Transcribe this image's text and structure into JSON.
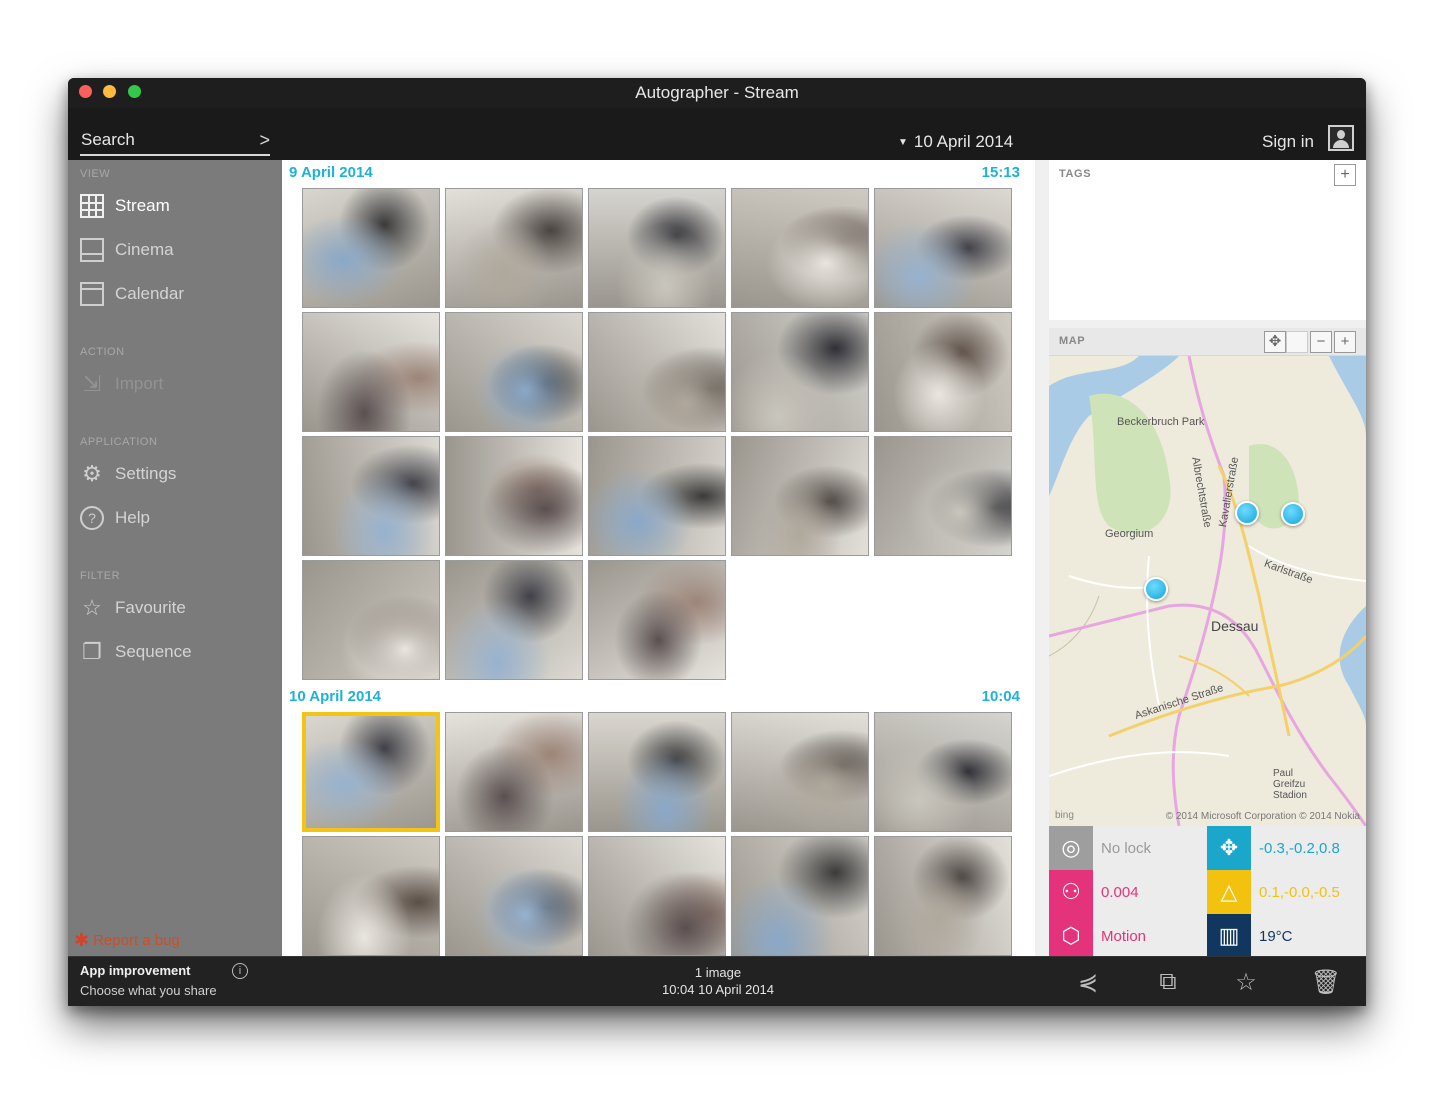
{
  "window": {
    "title": "Autographer - Stream"
  },
  "toolbar": {
    "search_label": "Search",
    "search_chevron": ">",
    "date": "10 April 2014",
    "signin": "Sign in"
  },
  "sidebar": {
    "sections": {
      "view": "VIEW",
      "action": "ACTION",
      "application": "APPLICATION",
      "filter": "FILTER"
    },
    "items": {
      "stream": "Stream",
      "cinema": "Cinema",
      "calendar": "Calendar",
      "import": "Import",
      "settings": "Settings",
      "help": "Help",
      "favourite": "Favourite",
      "sequence": "Sequence"
    },
    "report_bug": "Report a bug"
  },
  "groups": [
    {
      "date": "9 April 2014",
      "time": "15:13",
      "count": 18
    },
    {
      "date": "10 April 2014",
      "time": "10:04",
      "count": 10
    }
  ],
  "right_panel": {
    "tags_label": "TAGS",
    "map_label": "MAP",
    "map_labels": {
      "park": "Beckerbruch Park",
      "georgium": "Georgium",
      "albrecht": "Albrechtstraße",
      "askanische": "Askanische Straße",
      "kavalier": "Kavalierstraße",
      "dessau": "Dessau",
      "karlstrasse": "Karlstraße",
      "paul": "Paul Greifzu Stadion",
      "bing": "bing",
      "copyright": "© 2014 Microsoft Corporation © 2014 Nokia"
    },
    "sensors": {
      "gps": "No lock",
      "accel": "-0.3,-0.2,0.8",
      "light": "0.004",
      "magnet": "0.1,-0.0,-0.5",
      "motion": "Motion",
      "temp": "19°C"
    },
    "colors": {
      "gray": "#9e9e9e",
      "cyan": "#1ba6cc",
      "pink": "#e4337a",
      "yellow": "#f2c20f",
      "navy": "#12375e"
    }
  },
  "bottom": {
    "title": "App improvement",
    "subtitle": "Choose what you share",
    "info": "i",
    "count": "1 image",
    "timestamp": "10:04 10 April 2014"
  }
}
